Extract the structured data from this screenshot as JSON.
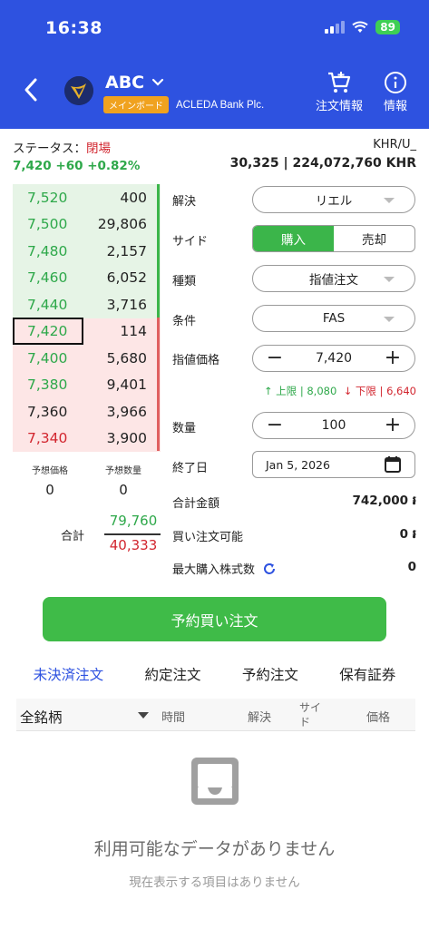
{
  "status_bar": {
    "time": "16:38",
    "battery": "89"
  },
  "header": {
    "ticker": "ABC",
    "board_badge": "メインボード",
    "company": "ACLEDA Bank Plc.",
    "action_order_info": "注文情報",
    "action_info": "情報"
  },
  "status": {
    "label": "ステータス：",
    "state": "閉場",
    "price_change": "7,420 +60 +0.82%",
    "currency_pair": "KHR/U_",
    "volume_value": "30,325 | 224,072,760 KHR"
  },
  "order_book": {
    "asks": [
      {
        "price": "7,520",
        "qty": "400",
        "color": "green"
      },
      {
        "price": "7,500",
        "qty": "29,806",
        "color": "green"
      },
      {
        "price": "7,480",
        "qty": "2,157",
        "color": "green"
      },
      {
        "price": "7,460",
        "qty": "6,052",
        "color": "green"
      },
      {
        "price": "7,440",
        "qty": "3,716",
        "color": "green"
      }
    ],
    "bids": [
      {
        "price": "7,420",
        "qty": "114",
        "color": "green",
        "selected": true
      },
      {
        "price": "7,400",
        "qty": "5,680",
        "color": "green"
      },
      {
        "price": "7,380",
        "qty": "9,401",
        "color": "green"
      },
      {
        "price": "7,360",
        "qty": "3,966",
        "color": "black"
      },
      {
        "price": "7,340",
        "qty": "3,900",
        "color": "red"
      }
    ],
    "est_price_label": "予想価格",
    "est_qty_label": "予想数量",
    "est_price": "0",
    "est_qty": "0",
    "total_label": "合計",
    "total_ask": "79,760",
    "total_bid": "40,333"
  },
  "form": {
    "settlement_label": "解決",
    "settlement_value": "リエル",
    "side_label": "サイド",
    "side_buy": "購入",
    "side_sell": "売却",
    "type_label": "種類",
    "type_value": "指値注文",
    "condition_label": "条件",
    "condition_value": "FAS",
    "limit_price_label": "指値価格",
    "limit_price_value": "7,420",
    "upper_limit": "↑ 上限 | 8,080",
    "lower_limit": "↓ 下限 | 6,640",
    "quantity_label": "数量",
    "quantity_value": "100",
    "end_date_label": "終了日",
    "end_date_value": "Jan 5, 2026",
    "total_amount_label": "合計金額",
    "total_amount_value": "742,000 ៛",
    "buy_power_label": "買い注文可能",
    "buy_power_value": "0 ៛",
    "max_shares_label": "最大購入株式数",
    "max_shares_value": "0"
  },
  "submit_label": "予約買い注文",
  "tabs": [
    "未決済注文",
    "約定注文",
    "予約注文",
    "保有証券"
  ],
  "table": {
    "filter": "全銘柄",
    "columns": [
      "時間",
      "解決",
      "サイ\nド",
      "価格"
    ]
  },
  "empty": {
    "title": "利用可能なデータがありません",
    "subtitle": "現在表示する項目はありません"
  },
  "colors": {
    "header": "#2e52e0",
    "buy": "#3bb54a",
    "sell": "#d2262f"
  }
}
